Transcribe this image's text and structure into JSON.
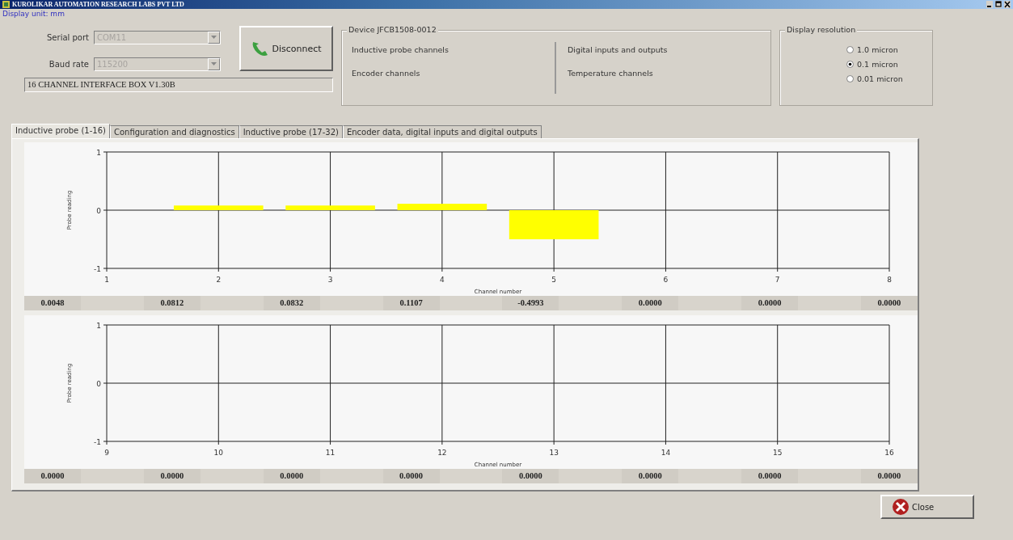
{
  "window": {
    "title": "KUROLIKAR AUTOMATION RESEARCH LABS PVT LTD"
  },
  "display_unit": "Display unit: mm",
  "connection": {
    "fields": [
      {
        "label": "Serial port",
        "value": "COM11",
        "disabled": true
      },
      {
        "label": "Baud rate",
        "value": "115200",
        "disabled": true
      }
    ],
    "button": "Disconnect",
    "info": "16 CHANNEL INTERFACE BOX V1.30B"
  },
  "device": {
    "title": "Device JFCB1508-0012",
    "columns": [
      [
        "Inductive probe channels",
        "Encoder channels"
      ],
      [
        "Digital inputs and outputs",
        "Temperature channels"
      ]
    ]
  },
  "resolution": {
    "title": "Display resolution",
    "options": [
      {
        "label": "1.0 micron",
        "selected": false
      },
      {
        "label": "0.1 micron",
        "selected": true
      },
      {
        "label": "0.01 micron",
        "selected": false
      }
    ]
  },
  "tabs": [
    {
      "label": "Inductive probe (1-16)",
      "selected": true
    },
    {
      "label": "Configuration and diagnostics",
      "selected": false
    },
    {
      "label": "Inductive probe (17-32)",
      "selected": false
    },
    {
      "label": "Encoder data, digital inputs and digital outputs",
      "selected": false
    }
  ],
  "charts": [
    {
      "chart_data": {
        "type": "bar",
        "xlabel": "Channel number",
        "ylabel": "Probe reading",
        "categories": [
          "1",
          "2",
          "3",
          "4",
          "5",
          "6",
          "7",
          "8"
        ],
        "values": [
          0,
          0.08,
          0.08,
          0.11,
          -0.5,
          0,
          0,
          0
        ],
        "ylim": [
          -1,
          1
        ],
        "yticks": [
          -1,
          0,
          1
        ],
        "grid": true
      },
      "readings": [
        "0.0048",
        "0.0812",
        "0.0832",
        "0.1107",
        "-0.4993",
        "0.0000",
        "0.0000",
        "0.0000"
      ]
    },
    {
      "chart_data": {
        "type": "bar",
        "xlabel": "Channel number",
        "ylabel": "Probe reading",
        "categories": [
          "9",
          "10",
          "11",
          "12",
          "13",
          "14",
          "15",
          "16"
        ],
        "values": [
          0,
          0,
          0,
          0,
          0,
          0,
          0,
          0
        ],
        "ylim": [
          -1,
          1
        ],
        "yticks": [
          -1,
          0,
          1
        ],
        "grid": true
      },
      "readings": [
        "0.0000",
        "0.0000",
        "0.0000",
        "0.0000",
        "0.0000",
        "0.0000",
        "0.0000",
        "0.0000"
      ]
    }
  ],
  "close_button": "Close"
}
